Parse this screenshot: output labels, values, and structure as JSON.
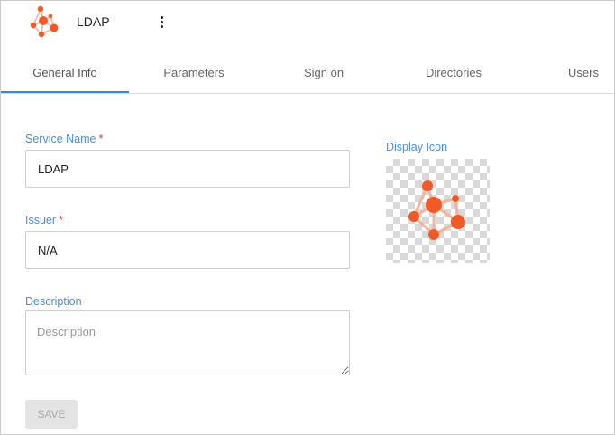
{
  "header": {
    "title": "LDAP",
    "logo_icon": "network-nodes-icon",
    "menu_icon": "kebab-menu-icon"
  },
  "tabs": [
    {
      "label": "General Info",
      "active": true
    },
    {
      "label": "Parameters",
      "active": false
    },
    {
      "label": "Sign on",
      "active": false
    },
    {
      "label": "Directories",
      "active": false
    },
    {
      "label": "Users",
      "active": false
    }
  ],
  "form": {
    "service_name": {
      "label": "Service Name",
      "required_mark": "*",
      "value": "LDAP"
    },
    "issuer": {
      "label": "Issuer",
      "required_mark": "*",
      "value": "N/A"
    },
    "description": {
      "label": "Description",
      "placeholder": "Description",
      "value": ""
    },
    "save_label": "SAVE"
  },
  "display_icon": {
    "label": "Display Icon",
    "icon": "network-nodes-icon"
  },
  "colors": {
    "accent": "#3a86d8",
    "label": "#4a8fdc",
    "required": "#d9363e",
    "icon_orange": "#f05a28"
  }
}
